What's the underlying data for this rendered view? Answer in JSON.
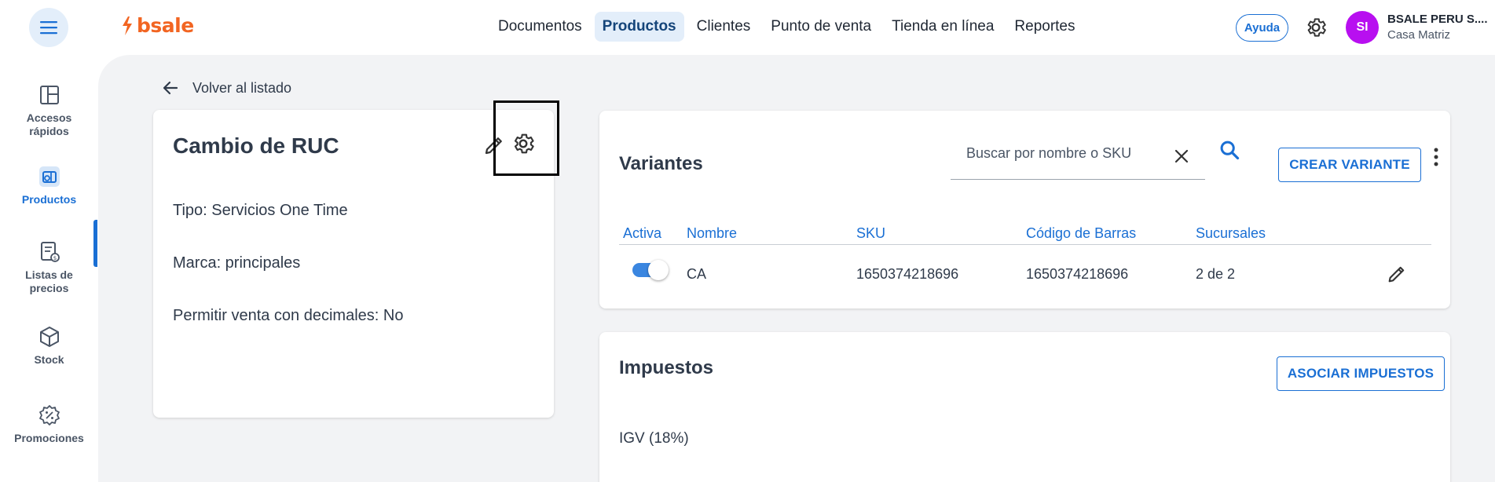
{
  "header": {
    "logo_text": "bsale",
    "nav": [
      "Documentos",
      "Productos",
      "Clientes",
      "Punto de venta",
      "Tienda en línea",
      "Reportes"
    ],
    "active_nav": "Productos",
    "help_label": "Ayuda",
    "avatar_initials": "SI",
    "account_name": "BSALE PERU S....",
    "account_branch": "Casa Matriz",
    "icons": [
      "menu-icon",
      "gear-icon"
    ]
  },
  "sidebar": {
    "items": [
      {
        "label": "Accesos rápidos",
        "icon": "dashboard-icon"
      },
      {
        "label": "Productos",
        "icon": "products-icon",
        "active": true
      },
      {
        "label": "Listas de precios",
        "icon": "price-list-icon"
      },
      {
        "label": "Stock",
        "icon": "box-icon"
      },
      {
        "label": "Promociones",
        "icon": "promotion-icon"
      }
    ]
  },
  "back": {
    "label": "Volver al listado"
  },
  "product": {
    "title": "Cambio de RUC",
    "tipo": "Tipo: Servicios One Time",
    "marca": "Marca: principales",
    "decimales": "Permitir venta con decimales: No"
  },
  "variants": {
    "title": "Variantes",
    "search_placeholder": "Buscar por nombre o SKU",
    "create_label": "CREAR VARIANTE",
    "columns": [
      "Activa",
      "Nombre",
      "SKU",
      "Código de Barras",
      "Sucursales"
    ],
    "rows": [
      {
        "active": true,
        "name": "CA",
        "sku": "1650374218696",
        "barcode": "1650374218696",
        "branches": "2 de 2"
      }
    ]
  },
  "taxes": {
    "title": "Impuestos",
    "associate_label": "ASOCIAR IMPUESTOS",
    "items": [
      "IGV (18%)"
    ]
  },
  "colors": {
    "brand": "#f26522",
    "accent": "#1a6fd4",
    "avatar": "#b80ff0"
  }
}
